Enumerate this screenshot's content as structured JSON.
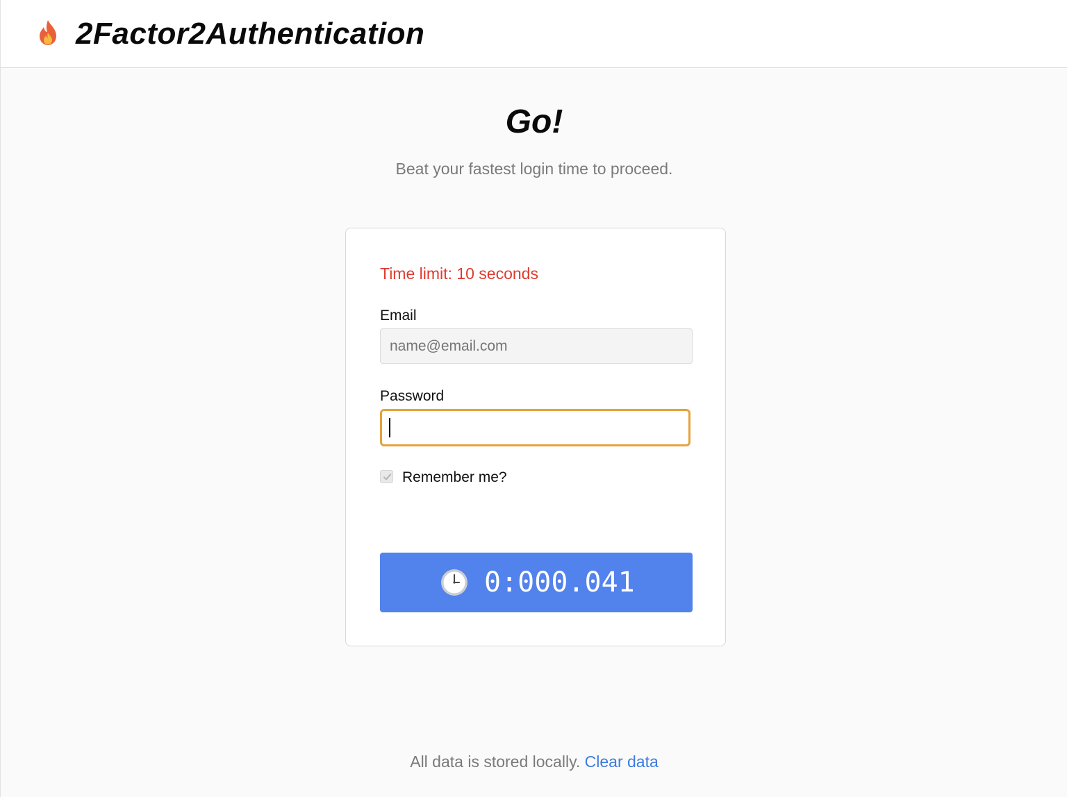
{
  "header": {
    "logo_icon": "fire-icon",
    "brand": "2Factor2Authentication"
  },
  "hero": {
    "title": "Go!",
    "subtitle": "Beat your fastest login time to proceed."
  },
  "form": {
    "time_limit": "Time limit: 10 seconds",
    "email_label": "Email",
    "email_placeholder": "name@email.com",
    "password_label": "Password",
    "password_value": "",
    "remember_label": "Remember me?",
    "remember_checked": true
  },
  "timer": {
    "icon": "clock-icon",
    "value": "0:000.041"
  },
  "footer": {
    "text": "All data is stored locally.",
    "link": "Clear data"
  },
  "colors": {
    "accent_button": "#5282ec",
    "warning_text": "#e03a2e",
    "focus_border": "#e6a23c",
    "link": "#3d7be0"
  }
}
